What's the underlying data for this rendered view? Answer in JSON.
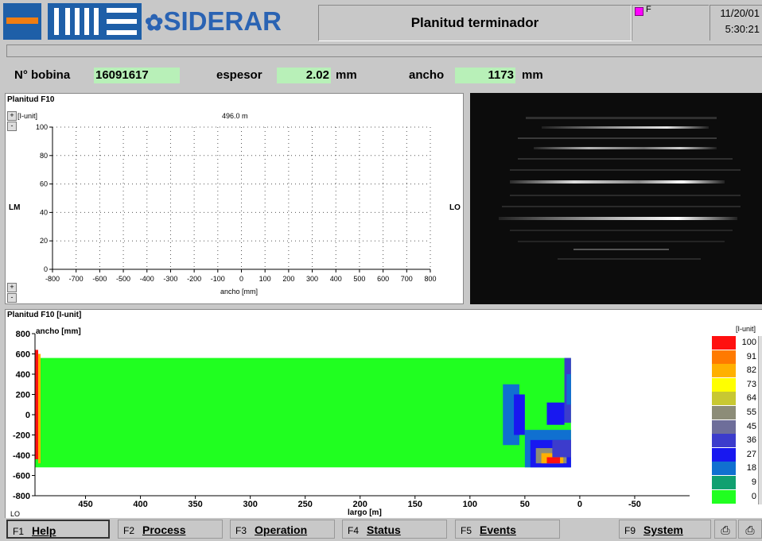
{
  "header": {
    "brand": "SIDERAR",
    "title": "Planitud terminador",
    "flag_label": "F",
    "date": "11/20/01",
    "time": "5:30:21"
  },
  "info": {
    "coil_label": "N° bobina",
    "coil_value": "16091617",
    "thickness_label": "espesor",
    "thickness_value": "2.02",
    "thickness_unit": "mm",
    "width_label": "ancho",
    "width_value": "1173",
    "width_unit": "mm"
  },
  "profile_panel": {
    "title": "Planitud F10",
    "unit": "[I-unit]",
    "position": "496.0 m",
    "left_label": "LM",
    "right_label": "LO",
    "xlabel": "ancho [mm]"
  },
  "map_panel": {
    "title": "Planitud F10 [I-unit]",
    "ylabel": "ancho [mm]",
    "xlabel": "largo [m]",
    "corner_label": "LO",
    "legend_unit": "[I-unit]"
  },
  "chart_data": [
    {
      "type": "line",
      "x_ticks": [
        -800,
        -700,
        -600,
        -500,
        -400,
        -300,
        -200,
        -100,
        0,
        100,
        200,
        300,
        400,
        500,
        600,
        700,
        800
      ],
      "y_ticks": [
        0,
        20,
        40,
        60,
        80,
        100
      ],
      "xlim": [
        -800,
        800
      ],
      "ylim": [
        0,
        100
      ],
      "grid": true,
      "series": []
    },
    {
      "type": "heatmap",
      "x_ticks": [
        450,
        400,
        350,
        300,
        250,
        200,
        150,
        100,
        50,
        0,
        -50
      ],
      "y_ticks": [
        800,
        600,
        400,
        200,
        0,
        -200,
        -400,
        -600,
        -800
      ],
      "xlim": [
        496,
        -100
      ],
      "ylim": [
        -800,
        800
      ],
      "legend": {
        "values": [
          100,
          91,
          82,
          73,
          64,
          55,
          45,
          36,
          27,
          18,
          9,
          0
        ],
        "colors": [
          "#ff1010",
          "#ff7a00",
          "#ffb000",
          "#ffff00",
          "#c8c832",
          "#8c8c78",
          "#6e6e9a",
          "#3c3ccc",
          "#1818f0",
          "#1070d0",
          "#10a070",
          "#20ff20"
        ]
      }
    }
  ],
  "footer": {
    "buttons": [
      {
        "key": "F1",
        "label": "Help"
      },
      {
        "key": "F2",
        "label": "Process"
      },
      {
        "key": "F3",
        "label": "Operation"
      },
      {
        "key": "F4",
        "label": "Status"
      },
      {
        "key": "F5",
        "label": "Events"
      },
      {
        "key": "F9",
        "label": "System"
      }
    ]
  },
  "colors": {
    "background": "#c8c8c8",
    "value_field": "#b8f0b8",
    "brand_blue": "#2a63b3",
    "brand_orange": "#f07d12"
  }
}
